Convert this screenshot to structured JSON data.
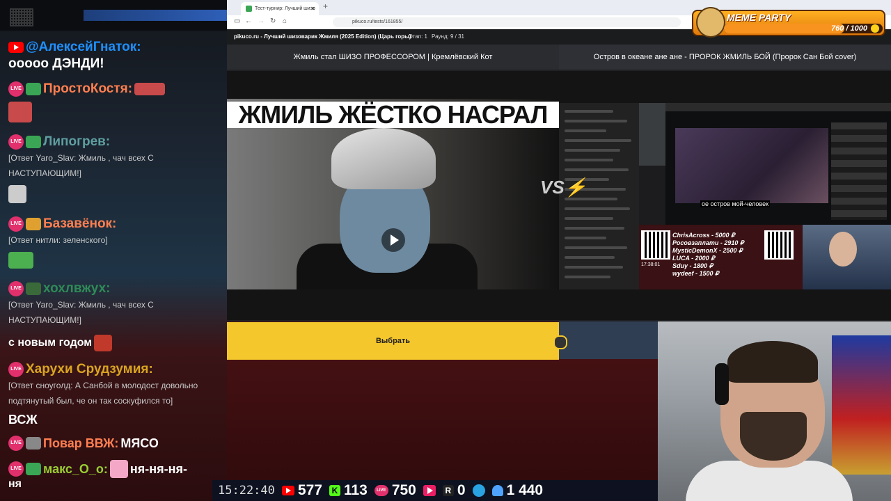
{
  "chat": {
    "messages": [
      {
        "user": "@АлексейГнаток:",
        "text": "ооооо ДЭНДИ!",
        "color": "#1e90ff",
        "platform": "youtube"
      },
      {
        "user": "ПростоКостя:",
        "color": "#ff7f50",
        "platform": "live"
      },
      {
        "user": "Липогрев:",
        "reply": "[Ответ Yaro_Slav: Жмиль , чач всех С НАСТУПАЮЩИМ!]",
        "color": "#5f9ea0",
        "platform": "live"
      },
      {
        "user": "Базавёнок:",
        "reply": "[Ответ нитли: зеленского]",
        "color": "#ff7f50",
        "platform": "live"
      },
      {
        "user": "хохлвжух:",
        "reply": "[Ответ Yaro_Slav: Жмиль , чач всех С НАСТУПАЮЩИМ!]",
        "color": "#2e8b57",
        "platform": "live"
      },
      {
        "text": "с новым годом"
      },
      {
        "user": "Харухи Срудзумия:",
        "reply": "[Ответ сноуголд: А Санбой в молодост довольно подтянутый был, че он так соскуфился то]",
        "color": "#daa520",
        "platform": "live"
      },
      {
        "text": "ВСЖ"
      },
      {
        "user": "Повар ВВЖ:",
        "text": "МЯСО",
        "color": "#ff7f50",
        "platform": "live"
      },
      {
        "user": "макс_О_о:",
        "text": "ня-ня-ня-",
        "color": "#9acd32",
        "platform": "live"
      },
      {
        "text": "ня"
      }
    ],
    "live_badge": "LIVE"
  },
  "browser": {
    "tab_title": "Тест-турнир: Лучший шизо",
    "url": "pikuco.ru/tests/161855/",
    "site_title": "pikuco.ru - Лучший шизоварик Жмиля (2025 Edition) (Царь горы)",
    "stage": "Этап: 1",
    "round": "Раунд: 9 / 31",
    "left_video_title": "Жмиль стал ШИЗО ПРОФЕССОРОМ | Кремлёвский Кот",
    "right_video_title": "Остров в океане ане ане - ПРОРОК ЖМИЛЬ БОЙ (Пророк Сан Бой cover)",
    "left_caption": "ЖМИЛЬ ЖЁСТКО НАСРАЛ",
    "vs": "VS",
    "choose_label": "Выбрать",
    "right_subtitle": "ое остров мой-человек",
    "donations": [
      "ChrisAcross - 5000 ₽",
      "Росовзаплати - 2910 ₽",
      "MysticDemonX - 2500 ₽",
      "LUCA - 2000 ₽",
      "Sduy - 1800 ₽",
      "wydeef - 1500 ₽"
    ],
    "donate_time": "17:38:01"
  },
  "meme_party": {
    "label": "MEME PARTY",
    "current": "760 / 1000",
    "progress": 0.76
  },
  "stats": {
    "time": "15:22:40",
    "youtube": "577",
    "kick": "113",
    "live": "750",
    "rutube": "0",
    "viewers": "1 440"
  },
  "colors": {
    "accent_yellow": "#f4c72c",
    "meme_orange": "#f7931e"
  }
}
